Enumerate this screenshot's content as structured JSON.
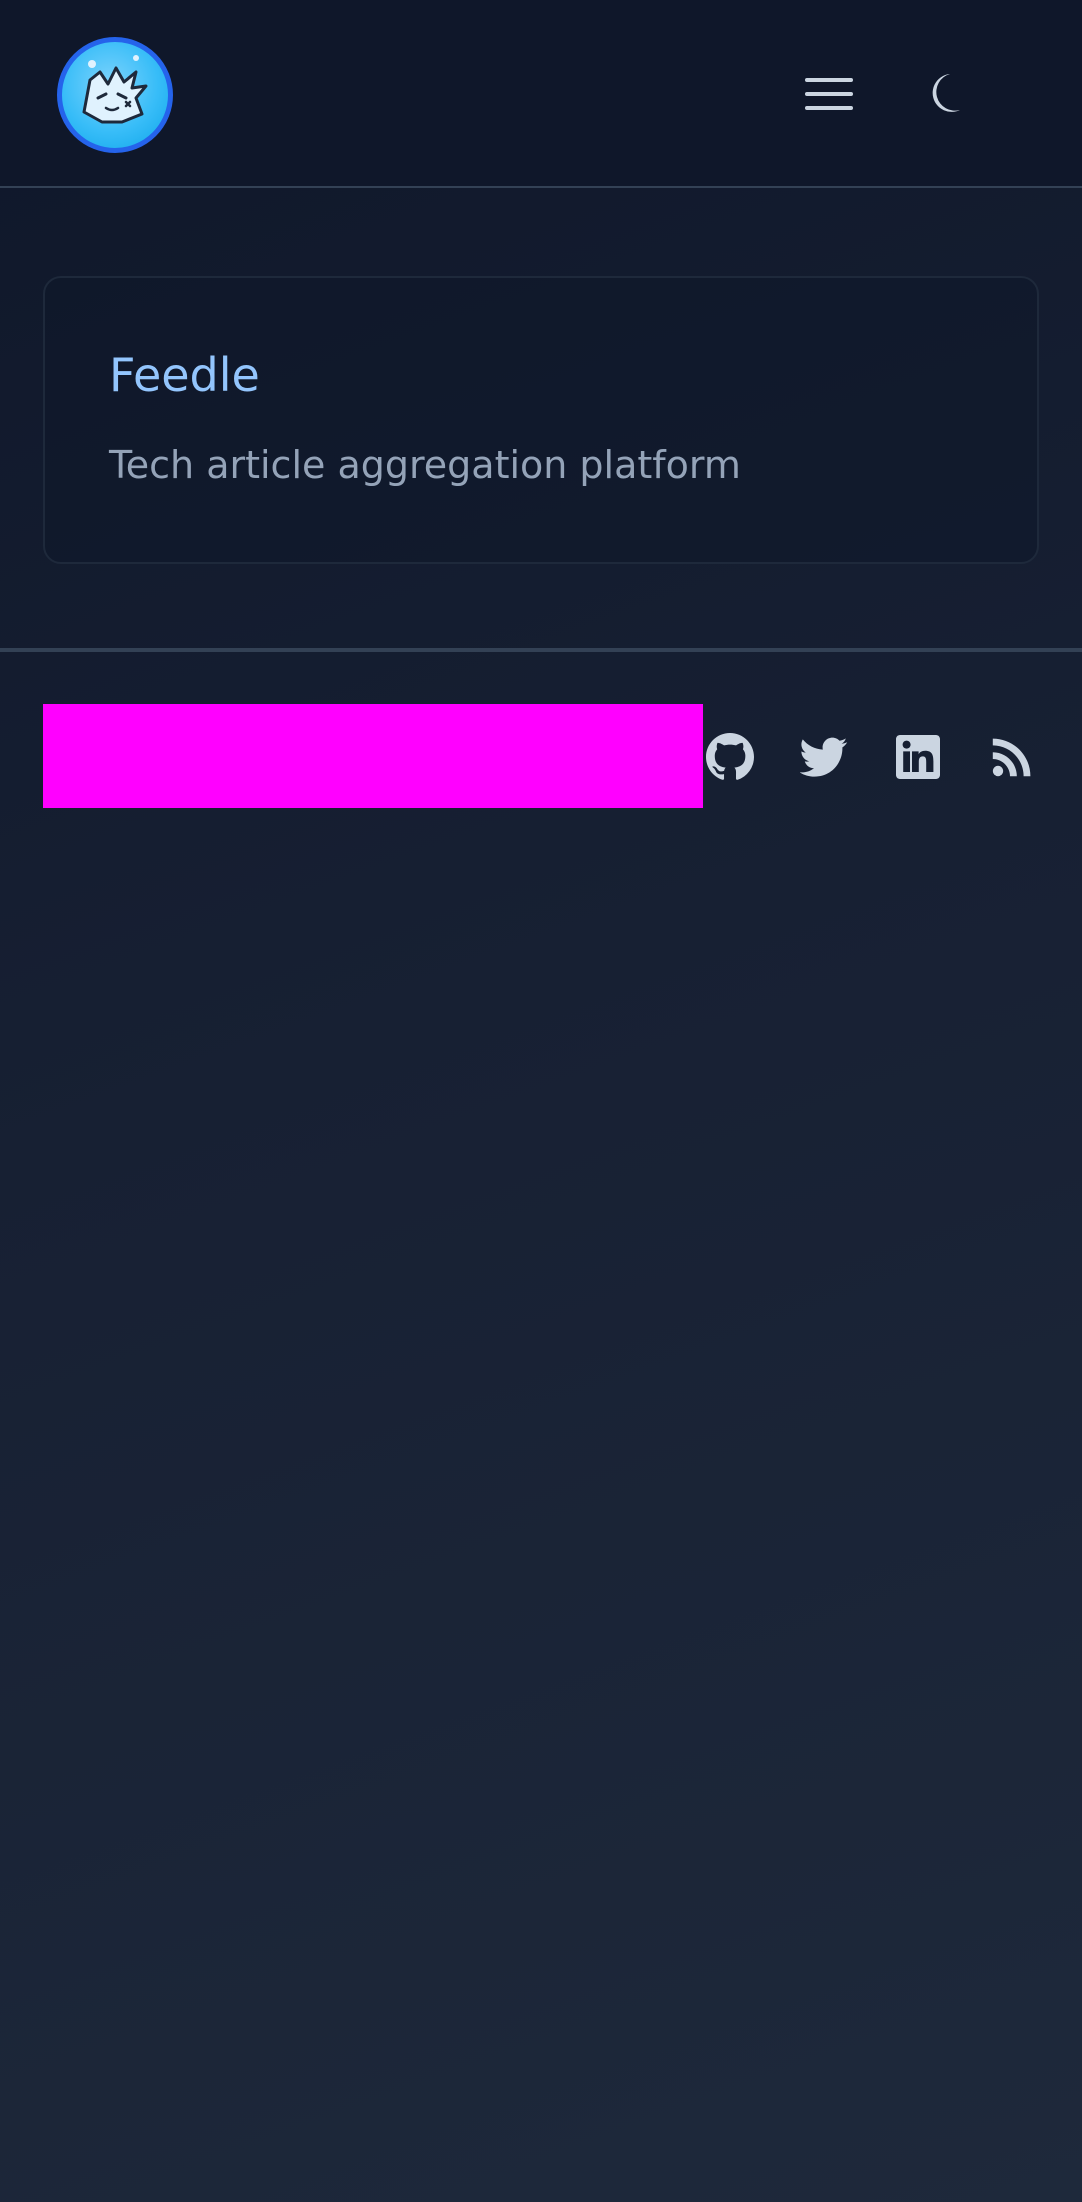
{
  "header": {
    "avatar_alt": "site avatar",
    "menu_icon": "hamburger-menu-icon",
    "theme_icon": "crescent-moon-icon"
  },
  "project": {
    "title": "Feedle",
    "description": "Tech article aggregation platform"
  },
  "footer": {
    "social_icons": [
      "github-icon",
      "twitter-icon",
      "linkedin-icon",
      "rss-icon"
    ]
  },
  "colors": {
    "page_bg": "#0f172a",
    "accent_title": "#93c5fd",
    "muted_text": "#94a3b8",
    "icon": "#cbd5e1",
    "divider": "#334155",
    "redacted": "#ff00ff",
    "avatar_ring": "#2563eb"
  }
}
